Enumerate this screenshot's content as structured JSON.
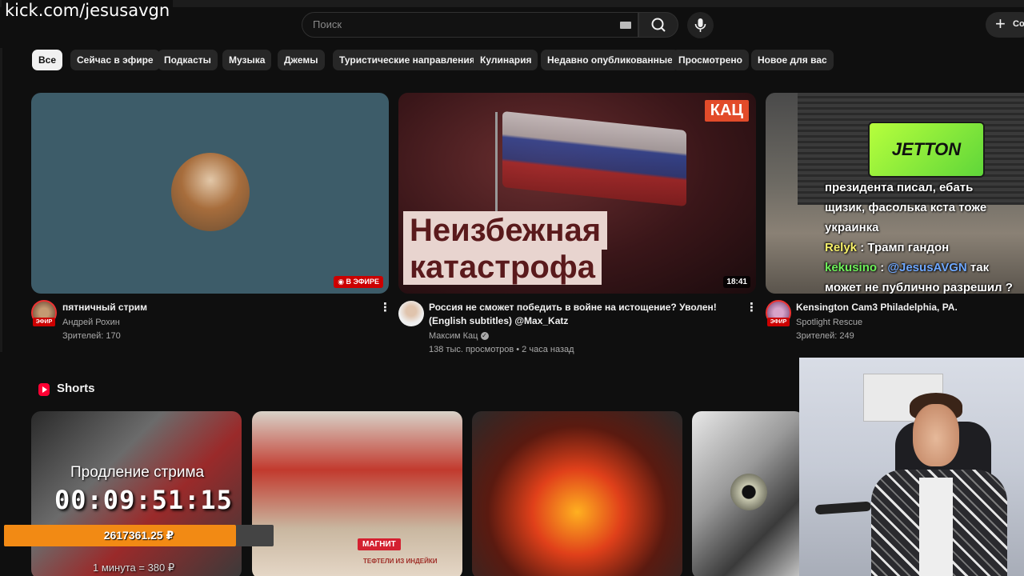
{
  "overlay": {
    "channel_url": "kick.com/jesusavgn"
  },
  "header": {
    "search_placeholder": "Поиск",
    "create_label": "Co"
  },
  "chips": [
    {
      "label": "Все",
      "active": true
    },
    {
      "label": "Сейчас в эфире"
    },
    {
      "label": "Подкасты"
    },
    {
      "label": "Музыка"
    },
    {
      "label": "Джемы"
    },
    {
      "label": "Туристические направления"
    },
    {
      "label": "Кулинария"
    },
    {
      "label": "Недавно опубликованные"
    },
    {
      "label": "Просмотрено"
    },
    {
      "label": "Новое для вас"
    }
  ],
  "videos": [
    {
      "title": "пятничный стрим",
      "channel": "Андрей Рохин",
      "stats": "Зрителей: 170",
      "badge": "В ЭФИРЕ",
      "avatar_badge": "ЭФИР"
    },
    {
      "title_line1": "Россия не сможет победить в войне на истощение? Уволен!",
      "title_line2": "(English subtitles) @Max_Katz",
      "channel": "Максим Кац",
      "stats": "138 тыс. просмотров • 2 часа назад",
      "duration": "18:41",
      "logo": "КАЦ",
      "thumb_text_line1": "Неизбежная",
      "thumb_text_line2": "катастрофа"
    },
    {
      "title": "Kensington Cam3  Philadelphia, PA.",
      "channel": "Spotlight Rescue",
      "stats": "Зрителей: 249",
      "avatar_badge": "ЭФИР"
    }
  ],
  "stream_chat": {
    "ad_logo": "JETTON",
    "line1": "президента писал, ебать",
    "line2": "щизик, фасолька кста тоже",
    "line3": "украинка",
    "msg1_user": "Relyk",
    "msg1_text": " : Трамп гандон",
    "msg2_user": "kekusino",
    "msg2_sep": " : ",
    "msg2_mention": "@JesusAVGN",
    "msg2_text": " так",
    "msg2_cont": "может не публично разрешил ?"
  },
  "shorts": {
    "label": "Shorts"
  },
  "stream_overlay": {
    "extension_label": "Продление стрима",
    "timer": "00:09:51:15",
    "donation_amount": "2617361.25 ₽",
    "donation_progress": 0.86,
    "donation_rate": "1 минута = 380 ₽",
    "product_brand": "МАГНИТ",
    "product_name": "ТЕФТЕЛИ ИЗ ИНДЕЙКИ"
  },
  "colors": {
    "background": "#0f0f0f",
    "chip": "#272727",
    "live_red": "#cc0000",
    "donation_orange": "#f28a14"
  }
}
